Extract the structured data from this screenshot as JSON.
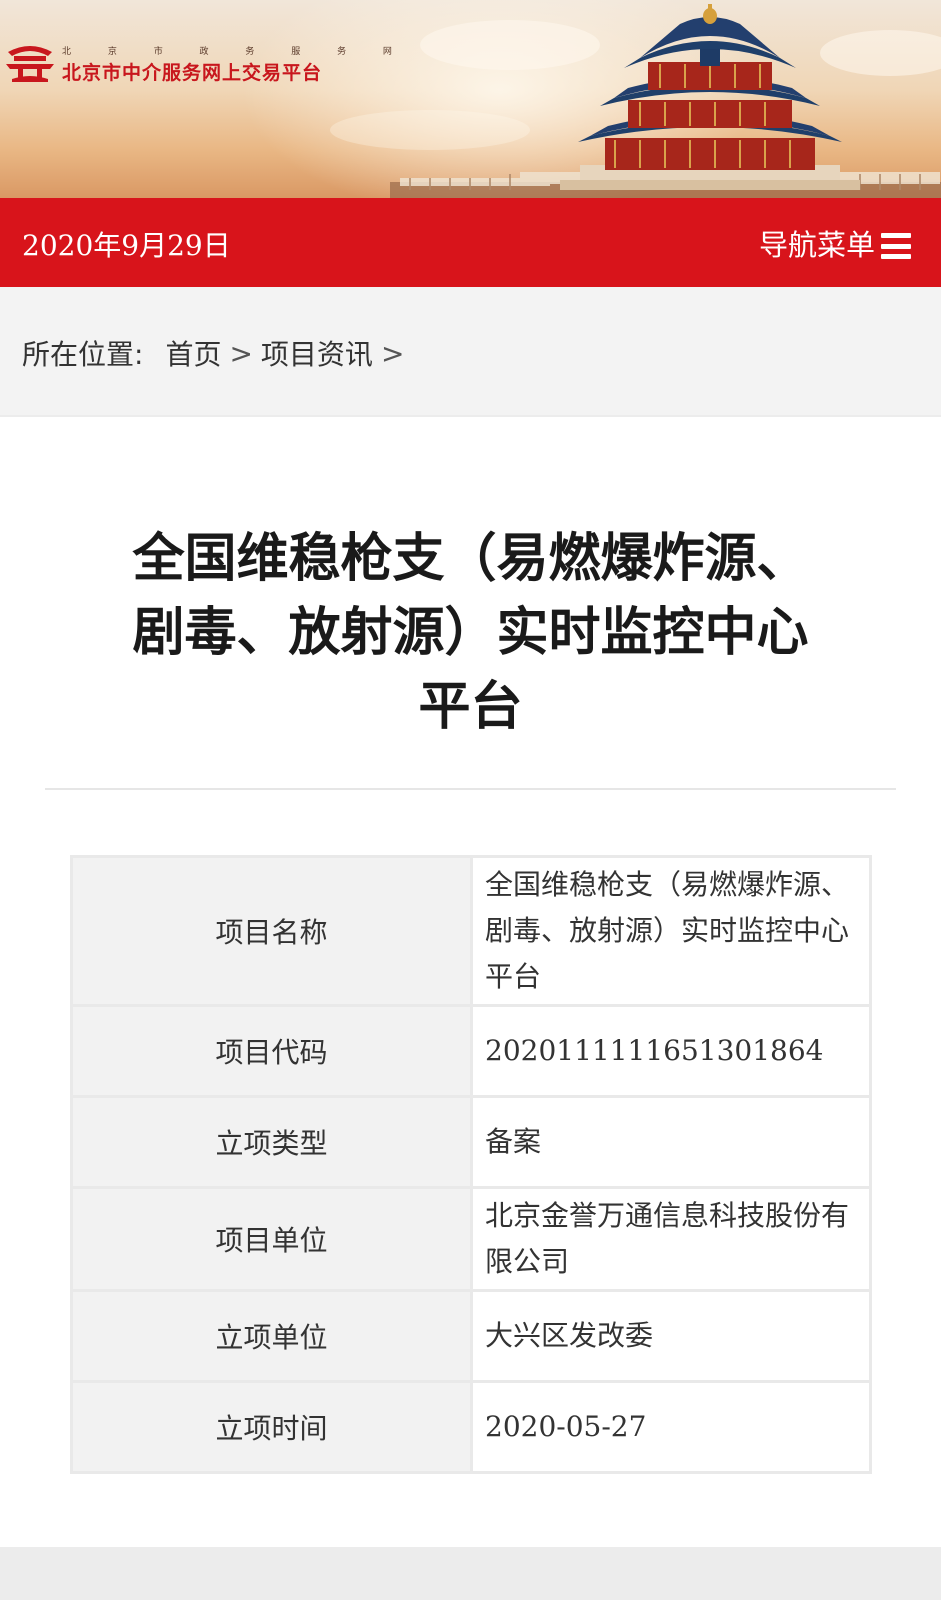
{
  "header": {
    "site_subtitle_chars": [
      "北",
      "京",
      "市",
      "政",
      "务",
      "服",
      "务",
      "网"
    ],
    "site_title": "北京市中介服务网上交易平台",
    "brand_color": "#d8141b"
  },
  "datebar": {
    "date": "2020年9月29日",
    "nav_label": "导航菜单",
    "nav_icon": "hamburger-icon"
  },
  "breadcrumb": {
    "prefix": "所在位置:",
    "items": [
      "首页",
      "项目资讯"
    ],
    "separator": ">"
  },
  "article": {
    "title_lines": [
      "全国维稳枪支（易燃爆炸源、",
      "剧毒、放射源）实时监控中心",
      "平台"
    ]
  },
  "details": [
    {
      "label": "项目名称",
      "value": "全国维稳枪支（易燃爆炸源、剧毒、放射源）实时监控中心平台"
    },
    {
      "label": "项目代码",
      "value": "2020111111651301864"
    },
    {
      "label": "立项类型",
      "value": "备案"
    },
    {
      "label": "项目单位",
      "value": "北京金誉万通信息科技股份有限公司"
    },
    {
      "label": "立项单位",
      "value": "大兴区发改委"
    },
    {
      "label": "立项时间",
      "value": "2020-05-27"
    }
  ]
}
